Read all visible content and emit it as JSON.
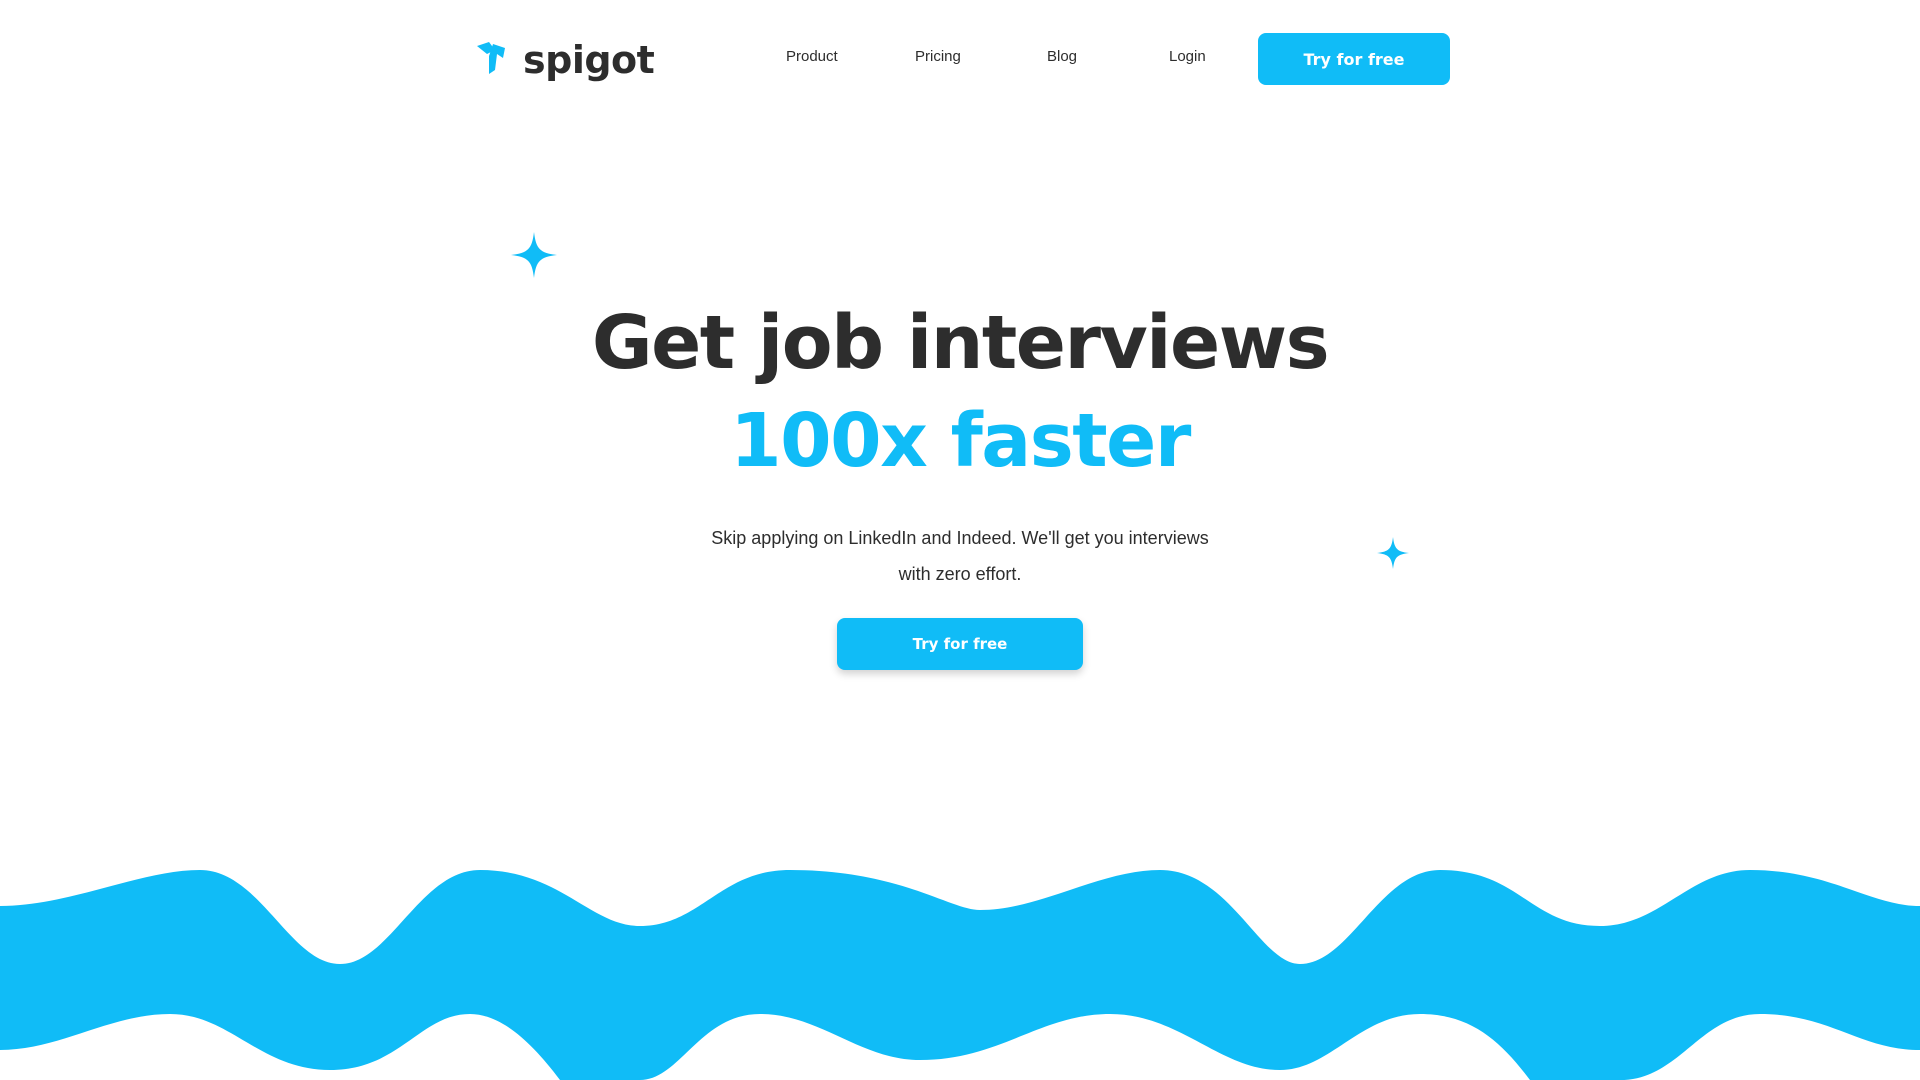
{
  "brand": {
    "name": "spigot",
    "logo_icon": "spigot-faucet-icon",
    "accent_color": "#10bcf7",
    "text_color": "#2d2d2d"
  },
  "nav": {
    "items": [
      {
        "label": "Product"
      },
      {
        "label": "Pricing"
      },
      {
        "label": "Blog"
      },
      {
        "label": "Login"
      }
    ],
    "cta_label": "Try for free"
  },
  "hero": {
    "title": "Get job interviews",
    "accent": "100x faster",
    "subtitle": "Skip applying on LinkedIn and Indeed. We'll get you interviews with zero effort.",
    "cta_label": "Try for free"
  },
  "decor": {
    "sparkle_icon": "sparkle-icon",
    "wave": "wave-decoration"
  }
}
